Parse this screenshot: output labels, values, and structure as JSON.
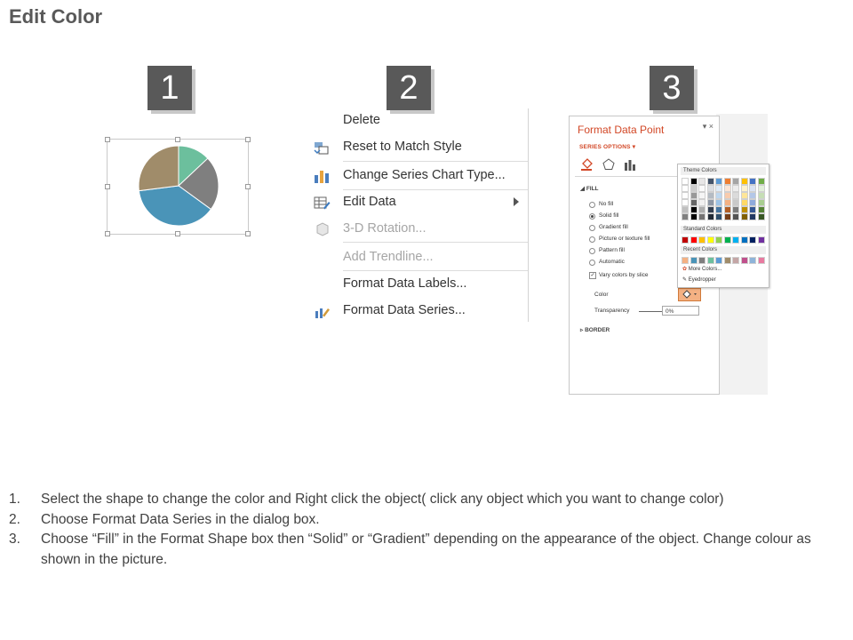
{
  "page_title": "Edit Color",
  "steps": [
    "1",
    "2",
    "3"
  ],
  "chart": {
    "slices": [
      {
        "name": "slice-green",
        "value": 13,
        "color": "#6cbf9d"
      },
      {
        "name": "slice-gray",
        "value": 22,
        "color": "#7f7f7f"
      },
      {
        "name": "slice-blue",
        "value": 38,
        "color": "#4a94b8"
      },
      {
        "name": "slice-tan",
        "value": 27,
        "color": "#a08c6a"
      }
    ]
  },
  "context_menu": {
    "items": [
      {
        "label": "Delete",
        "icon": "none",
        "disabled": false
      },
      {
        "label": "Reset to Match Style",
        "icon": "reset-style-icon",
        "disabled": false
      },
      {
        "label": "Change Series Chart Type...",
        "icon": "bar-chart-icon",
        "disabled": false
      },
      {
        "label": "Edit Data",
        "icon": "edit-data-icon",
        "disabled": false,
        "submenu": true
      },
      {
        "label": "3-D Rotation...",
        "icon": "cube-icon",
        "disabled": true
      },
      {
        "label": "Add Trendline...",
        "icon": "none",
        "disabled": true
      },
      {
        "label": "Format Data Labels...",
        "icon": "none",
        "disabled": false
      },
      {
        "label": "Format Data Series...",
        "icon": "format-series-icon",
        "disabled": false
      }
    ]
  },
  "format_pane": {
    "title": "Format Data Point",
    "close": "▾ ×",
    "series_options": "SERIES OPTIONS",
    "fill_section": "FILL",
    "fill_options": [
      {
        "label": "No fill",
        "selected": false
      },
      {
        "label": "Solid fill",
        "selected": true
      },
      {
        "label": "Gradient fill",
        "selected": false
      },
      {
        "label": "Picture or texture fill",
        "selected": false
      },
      {
        "label": "Pattern fill",
        "selected": false
      },
      {
        "label": "Automatic",
        "selected": false
      }
    ],
    "vary_colors": "Vary colors by slice",
    "color_label": "Color",
    "transparency_label": "Transparency",
    "transparency_value": "0%",
    "border_section": "BORDER"
  },
  "palette": {
    "theme_header": "Theme Colors",
    "standard_header": "Standard Colors",
    "recent_header": "Recent Colors",
    "more_colors": "More Colors...",
    "eyedropper": "Eyedropper",
    "theme_colors": [
      "#ffffff",
      "#000000",
      "#e7e6e6",
      "#44546a",
      "#5b9bd5",
      "#ed7d31",
      "#a5a5a5",
      "#ffc000",
      "#4472c4",
      "#70ad47"
    ],
    "standard_colors": [
      "#c00000",
      "#ff0000",
      "#ffc000",
      "#ffff00",
      "#92d050",
      "#00b050",
      "#00b0f0",
      "#0070c0",
      "#002060",
      "#7030a0"
    ],
    "recent_colors": [
      "#f4b183",
      "#4a94b8",
      "#7f7f7f",
      "#6cbf9d",
      "#5b9bd5",
      "#a08c6a",
      "#c4a6a6",
      "#c0508c",
      "#8fb4d9",
      "#e87aa0"
    ]
  },
  "instructions": [
    {
      "num": "1.",
      "text": "Select the shape to change the color and Right click the object( click any object which you want to change color)"
    },
    {
      "num": "2.",
      "text": "Choose Format Data Series in the dialog box."
    },
    {
      "num": "3.",
      "text": "Choose “Fill” in the Format Shape box then “Solid” or “Gradient” depending on the appearance of the object. Change colour as shown in the picture."
    }
  ]
}
